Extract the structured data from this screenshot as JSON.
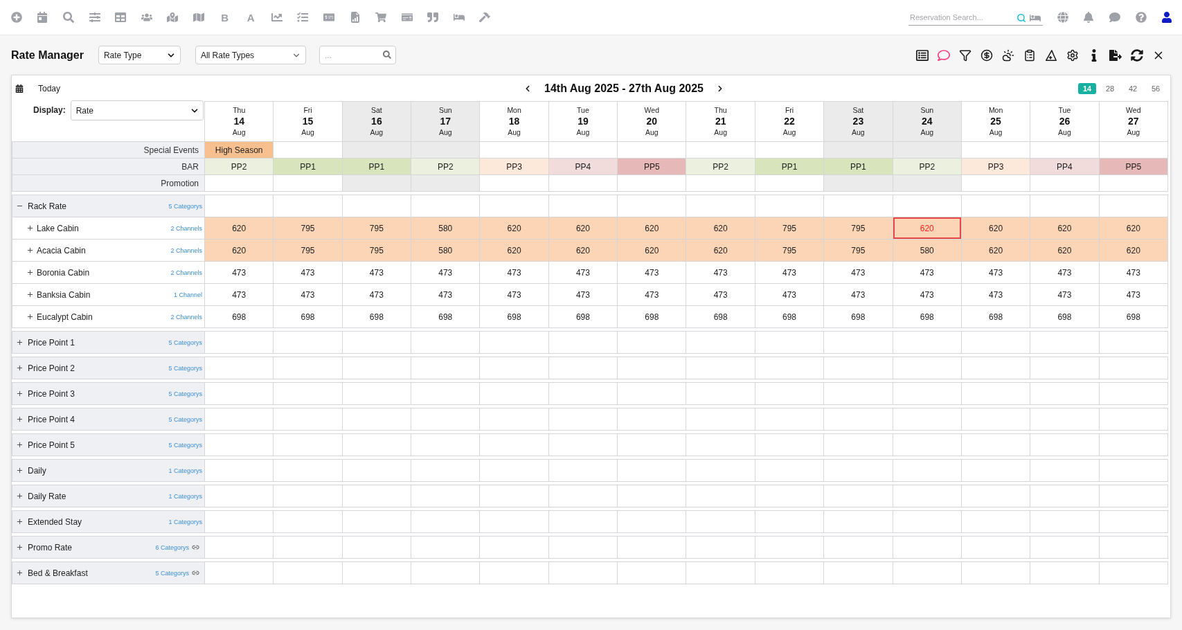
{
  "top_bar": {
    "letter_tools": [
      "B",
      "A"
    ],
    "reservation_search": {
      "placeholder": "Reservation Search..."
    }
  },
  "header": {
    "title": "Rate Manager",
    "filters": [
      {
        "value": "Rate Type"
      },
      {
        "value": "All Rate Types"
      }
    ],
    "search": {
      "placeholder": "..."
    }
  },
  "toolbar": {
    "today": "Today",
    "date_range": "14th Aug 2025 - 27th Aug 2025",
    "ranges": [
      {
        "label": "14",
        "selected": true
      },
      {
        "label": "28",
        "selected": false
      },
      {
        "label": "42",
        "selected": false
      },
      {
        "label": "56",
        "selected": false
      }
    ]
  },
  "grid": {
    "display": {
      "label": "Display:",
      "value": "Rate"
    },
    "days": [
      {
        "weekday": "Thu",
        "date": "14",
        "month": "Aug",
        "weekend": false,
        "event": {
          "label": "High Season",
          "color": "#f9c08f"
        },
        "bar": {
          "label": "PP2",
          "color": "#ebf1de"
        }
      },
      {
        "weekday": "Fri",
        "date": "15",
        "month": "Aug",
        "weekend": false,
        "bar": {
          "label": "PP1",
          "color": "#d8e4bc"
        }
      },
      {
        "weekday": "Sat",
        "date": "16",
        "month": "Aug",
        "weekend": true,
        "bar": {
          "label": "PP1",
          "color": "#d8e4bc"
        }
      },
      {
        "weekday": "Sun",
        "date": "17",
        "month": "Aug",
        "weekend": true,
        "bar": {
          "label": "PP2",
          "color": "#ebf1de"
        }
      },
      {
        "weekday": "Mon",
        "date": "18",
        "month": "Aug",
        "weekend": false,
        "bar": {
          "label": "PP3",
          "color": "#fde9d9"
        }
      },
      {
        "weekday": "Tue",
        "date": "19",
        "month": "Aug",
        "weekend": false,
        "bar": {
          "label": "PP4",
          "color": "#f2dcdb"
        }
      },
      {
        "weekday": "Wed",
        "date": "20",
        "month": "Aug",
        "weekend": false,
        "bar": {
          "label": "PP5",
          "color": "#e6b8b7"
        }
      },
      {
        "weekday": "Thu",
        "date": "21",
        "month": "Aug",
        "weekend": false,
        "bar": {
          "label": "PP2",
          "color": "#ebf1de"
        }
      },
      {
        "weekday": "Fri",
        "date": "22",
        "month": "Aug",
        "weekend": false,
        "bar": {
          "label": "PP1",
          "color": "#d8e4bc"
        }
      },
      {
        "weekday": "Sat",
        "date": "23",
        "month": "Aug",
        "weekend": true,
        "bar": {
          "label": "PP1",
          "color": "#d8e4bc"
        }
      },
      {
        "weekday": "Sun",
        "date": "24",
        "month": "Aug",
        "weekend": true,
        "bar": {
          "label": "PP2",
          "color": "#ebf1de"
        }
      },
      {
        "weekday": "Mon",
        "date": "25",
        "month": "Aug",
        "weekend": false,
        "bar": {
          "label": "PP3",
          "color": "#fde9d9"
        }
      },
      {
        "weekday": "Tue",
        "date": "26",
        "month": "Aug",
        "weekend": false,
        "bar": {
          "label": "PP4",
          "color": "#f2dcdb"
        }
      },
      {
        "weekday": "Wed",
        "date": "27",
        "month": "Aug",
        "weekend": false,
        "bar": {
          "label": "PP5",
          "color": "#e6b8b7"
        }
      }
    ],
    "top_rows": [
      {
        "label": "Special Events",
        "kind": "event"
      },
      {
        "label": "BAR",
        "kind": "bar"
      },
      {
        "label": "Promotion",
        "kind": "promotion"
      }
    ],
    "groups": [
      {
        "name": "Rack Rate",
        "count": "5 Categorys",
        "expanded": true,
        "linked": false,
        "rooms": [
          {
            "name": "Lake Cabin",
            "channels": "2 Channels",
            "expanded": false,
            "highlighted": true,
            "rates": [
              {
                "value": "620",
                "selected": false
              },
              {
                "value": "795",
                "selected": false
              },
              {
                "value": "795",
                "selected": false
              },
              {
                "value": "580",
                "selected": false
              },
              {
                "value": "620",
                "selected": false
              },
              {
                "value": "620",
                "selected": false
              },
              {
                "value": "620",
                "selected": false
              },
              {
                "value": "620",
                "selected": false
              },
              {
                "value": "795",
                "selected": false
              },
              {
                "value": "795",
                "selected": false
              },
              {
                "value": "620",
                "selected": true
              },
              {
                "value": "620",
                "selected": false
              },
              {
                "value": "620",
                "selected": false
              },
              {
                "value": "620",
                "selected": false
              }
            ]
          },
          {
            "name": "Acacia Cabin",
            "channels": "2 Channels",
            "expanded": false,
            "highlighted": true,
            "rates": [
              {
                "value": "620",
                "selected": false
              },
              {
                "value": "795",
                "selected": false
              },
              {
                "value": "795",
                "selected": false
              },
              {
                "value": "580",
                "selected": false
              },
              {
                "value": "620",
                "selected": false
              },
              {
                "value": "620",
                "selected": false
              },
              {
                "value": "620",
                "selected": false
              },
              {
                "value": "620",
                "selected": false
              },
              {
                "value": "795",
                "selected": false
              },
              {
                "value": "795",
                "selected": false
              },
              {
                "value": "580",
                "selected": false
              },
              {
                "value": "620",
                "selected": false
              },
              {
                "value": "620",
                "selected": false
              },
              {
                "value": "620",
                "selected": false
              }
            ]
          },
          {
            "name": "Boronia Cabin",
            "channels": "2 Channels",
            "expanded": false,
            "highlighted": false,
            "rates": [
              {
                "value": "473",
                "selected": false
              },
              {
                "value": "473",
                "selected": false
              },
              {
                "value": "473",
                "selected": false
              },
              {
                "value": "473",
                "selected": false
              },
              {
                "value": "473",
                "selected": false
              },
              {
                "value": "473",
                "selected": false
              },
              {
                "value": "473",
                "selected": false
              },
              {
                "value": "473",
                "selected": false
              },
              {
                "value": "473",
                "selected": false
              },
              {
                "value": "473",
                "selected": false
              },
              {
                "value": "473",
                "selected": false
              },
              {
                "value": "473",
                "selected": false
              },
              {
                "value": "473",
                "selected": false
              },
              {
                "value": "473",
                "selected": false
              }
            ]
          },
          {
            "name": "Banksia Cabin",
            "channels": "1 Channel",
            "expanded": false,
            "highlighted": false,
            "rates": [
              {
                "value": "473",
                "selected": false
              },
              {
                "value": "473",
                "selected": false
              },
              {
                "value": "473",
                "selected": false
              },
              {
                "value": "473",
                "selected": false
              },
              {
                "value": "473",
                "selected": false
              },
              {
                "value": "473",
                "selected": false
              },
              {
                "value": "473",
                "selected": false
              },
              {
                "value": "473",
                "selected": false
              },
              {
                "value": "473",
                "selected": false
              },
              {
                "value": "473",
                "selected": false
              },
              {
                "value": "473",
                "selected": false
              },
              {
                "value": "473",
                "selected": false
              },
              {
                "value": "473",
                "selected": false
              },
              {
                "value": "473",
                "selected": false
              }
            ]
          },
          {
            "name": "Eucalypt Cabin",
            "channels": "2 Channels",
            "expanded": false,
            "highlighted": false,
            "rates": [
              {
                "value": "698",
                "selected": false
              },
              {
                "value": "698",
                "selected": false
              },
              {
                "value": "698",
                "selected": false
              },
              {
                "value": "698",
                "selected": false
              },
              {
                "value": "698",
                "selected": false
              },
              {
                "value": "698",
                "selected": false
              },
              {
                "value": "698",
                "selected": false
              },
              {
                "value": "698",
                "selected": false
              },
              {
                "value": "698",
                "selected": false
              },
              {
                "value": "698",
                "selected": false
              },
              {
                "value": "698",
                "selected": false
              },
              {
                "value": "698",
                "selected": false
              },
              {
                "value": "698",
                "selected": false
              },
              {
                "value": "698",
                "selected": false
              }
            ]
          }
        ]
      },
      {
        "name": "Price Point 1",
        "count": "5 Categorys",
        "expanded": false,
        "linked": false
      },
      {
        "name": "Price Point 2",
        "count": "5 Categorys",
        "expanded": false,
        "linked": false
      },
      {
        "name": "Price Point 3",
        "count": "5 Categorys",
        "expanded": false,
        "linked": false
      },
      {
        "name": "Price Point 4",
        "count": "5 Categorys",
        "expanded": false,
        "linked": false
      },
      {
        "name": "Price Point 5",
        "count": "5 Categorys",
        "expanded": false,
        "linked": false
      },
      {
        "name": "Daily",
        "count": "1 Categorys",
        "expanded": false,
        "linked": false
      },
      {
        "name": "Daily Rate",
        "count": "1 Categorys",
        "expanded": false,
        "linked": false
      },
      {
        "name": "Extended Stay",
        "count": "1 Categorys",
        "expanded": false,
        "linked": false
      },
      {
        "name": "Promo Rate",
        "count": "6 Categorys",
        "expanded": false,
        "linked": true
      },
      {
        "name": "Bed & Breakfast",
        "count": "5 Categorys",
        "expanded": false,
        "linked": true
      }
    ]
  }
}
